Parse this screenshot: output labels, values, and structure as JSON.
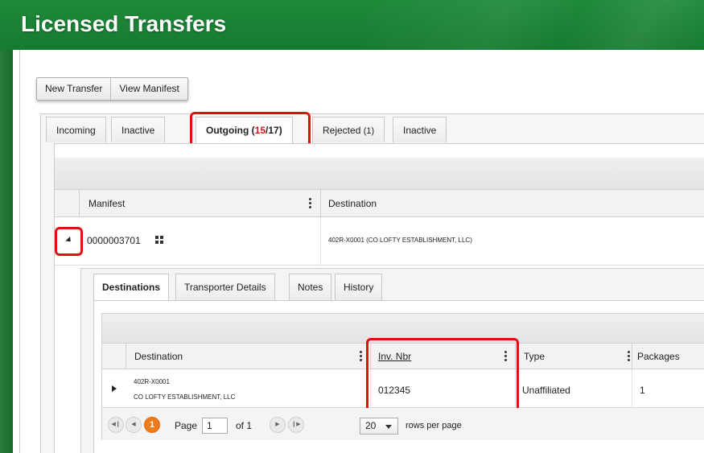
{
  "header": {
    "title": "Licensed Transfers"
  },
  "toolbar": {
    "new_transfer": "New Transfer",
    "view_manifest": "View Manifest"
  },
  "tabs": {
    "incoming": "Incoming",
    "inactive1": "Inactive",
    "outgoing_label": "Outgoing",
    "outgoing_open": "(",
    "outgoing_count": "15",
    "outgoing_total": "/17)",
    "rejected": "Rejected",
    "rejected_count": "(1)",
    "inactive2": "Inactive"
  },
  "grid": {
    "col_manifest": "Manifest",
    "col_destination": "Destination",
    "rows": [
      {
        "manifest": "0000003701",
        "destination": "402R-X0001 (CO LOFTY ESTABLISHMENT, LLC)"
      }
    ]
  },
  "detail_tabs": {
    "destinations": "Destinations",
    "transporter": "Transporter Details",
    "notes": "Notes",
    "history": "History"
  },
  "detail_grid": {
    "col_destination": "Destination",
    "col_inv": "Inv. Nbr",
    "col_type": "Type",
    "col_packages": "Packages",
    "rows": [
      {
        "dest_line1": "402R-X0001",
        "dest_line2": "CO LOFTY ESTABLISHMENT, LLC",
        "inv": "012345",
        "type": "Unaffiliated",
        "packages": "1"
      }
    ]
  },
  "pager": {
    "current_page": "1",
    "page_label": "Page",
    "page_value": "1",
    "of_label": "of 1",
    "rows_value": "20",
    "rows_label": "rows per page"
  },
  "colors": {
    "header_green": "#1f8a3a",
    "highlight_red": "#e01010",
    "pager_orange": "#f07b1c"
  }
}
